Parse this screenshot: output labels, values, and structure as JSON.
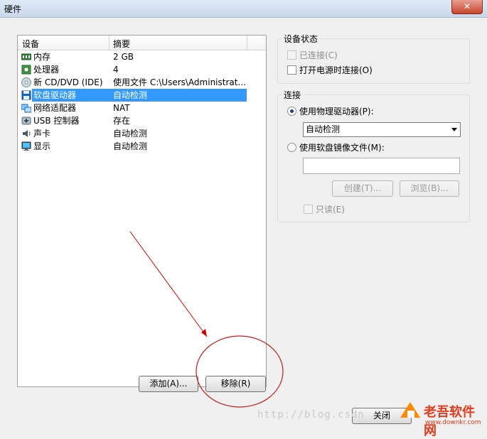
{
  "window": {
    "title": "硬件",
    "close_glyph": "✕"
  },
  "device_list": {
    "headers": [
      "设备",
      "摘要"
    ],
    "rows": [
      {
        "icon": "memory-icon",
        "name": "内存",
        "summary": "2 GB"
      },
      {
        "icon": "processor-icon",
        "name": "处理器",
        "summary": "4"
      },
      {
        "icon": "cd-dvd-icon",
        "name": "新 CD/DVD (IDE)",
        "summary": "使用文件 C:\\Users\\Administrat..."
      },
      {
        "icon": "floppy-icon",
        "name": "软盘驱动器",
        "summary": "自动检测",
        "selected": true
      },
      {
        "icon": "network-icon",
        "name": "网络适配器",
        "summary": "NAT"
      },
      {
        "icon": "usb-icon",
        "name": "USB 控制器",
        "summary": "存在"
      },
      {
        "icon": "sound-icon",
        "name": "声卡",
        "summary": "自动检测"
      },
      {
        "icon": "display-icon",
        "name": "显示",
        "summary": "自动检测"
      }
    ]
  },
  "buttons": {
    "add": "添加(A)...",
    "remove": "移除(R)",
    "close": "关闭"
  },
  "device_status": {
    "legend": "设备状态",
    "connected": "已连接(C)",
    "connect_on_power_on": "打开电源时连接(O)"
  },
  "connection": {
    "legend": "连接",
    "use_physical": "使用物理驱动器(P):",
    "physical_value": "自动检测",
    "use_image": "使用软盘镜像文件(M):",
    "image_path": "",
    "create": "创建(T)...",
    "browse": "浏览(B)...",
    "read_only": "只读(E)"
  },
  "overlay": {
    "watermark": "http://blog.csdn",
    "brand": "老吾软件网",
    "brand_url": "www.downkr.com"
  },
  "colors": {
    "selection": "#3399ff",
    "annotation": "#d00000"
  }
}
